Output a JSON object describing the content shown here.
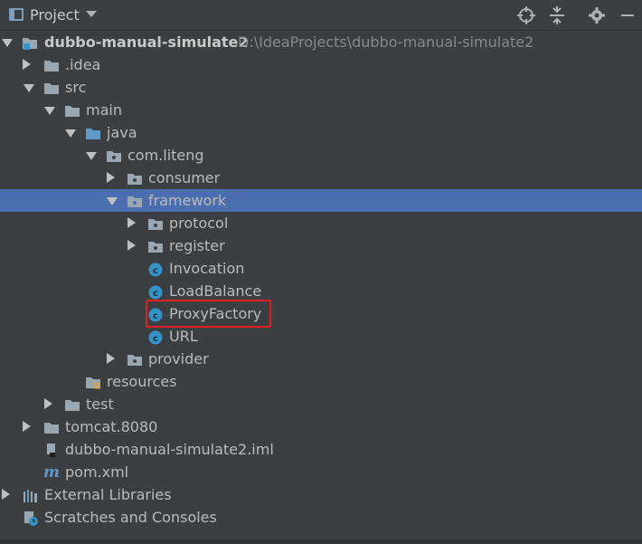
{
  "toolbar": {
    "title": "Project",
    "icons": [
      "project-view-icon",
      "dropdown-arrow-icon",
      "locate-icon",
      "collapse-all-icon",
      "gear-icon",
      "hide-icon"
    ]
  },
  "tree": {
    "root_label": "dubbo-manual-simulate2",
    "root_path": "D:\\IdeaProjects\\dubbo-manual-simulate2",
    "idea": ".idea",
    "src": "src",
    "main": "main",
    "java": "java",
    "package": "com.liteng",
    "consumer": "consumer",
    "framework": "framework",
    "protocol": "protocol",
    "register": "register",
    "invocation": "Invocation",
    "loadbalance": "LoadBalance",
    "proxyfactory": "ProxyFactory",
    "url": "URL",
    "provider": "provider",
    "resources": "resources",
    "test": "test",
    "tomcat": "tomcat.8080",
    "iml": "dubbo-manual-simulate2.iml",
    "pom": "pom.xml",
    "external_libraries": "External Libraries",
    "scratches": "Scratches and Consoles"
  },
  "colors": {
    "background": "#3c3f41",
    "selection": "#4b6eaf",
    "folder": "#9aa7b0",
    "source_folder": "#5e9ac7",
    "class_badge": "#3592c4",
    "highlight": "#e02020"
  }
}
